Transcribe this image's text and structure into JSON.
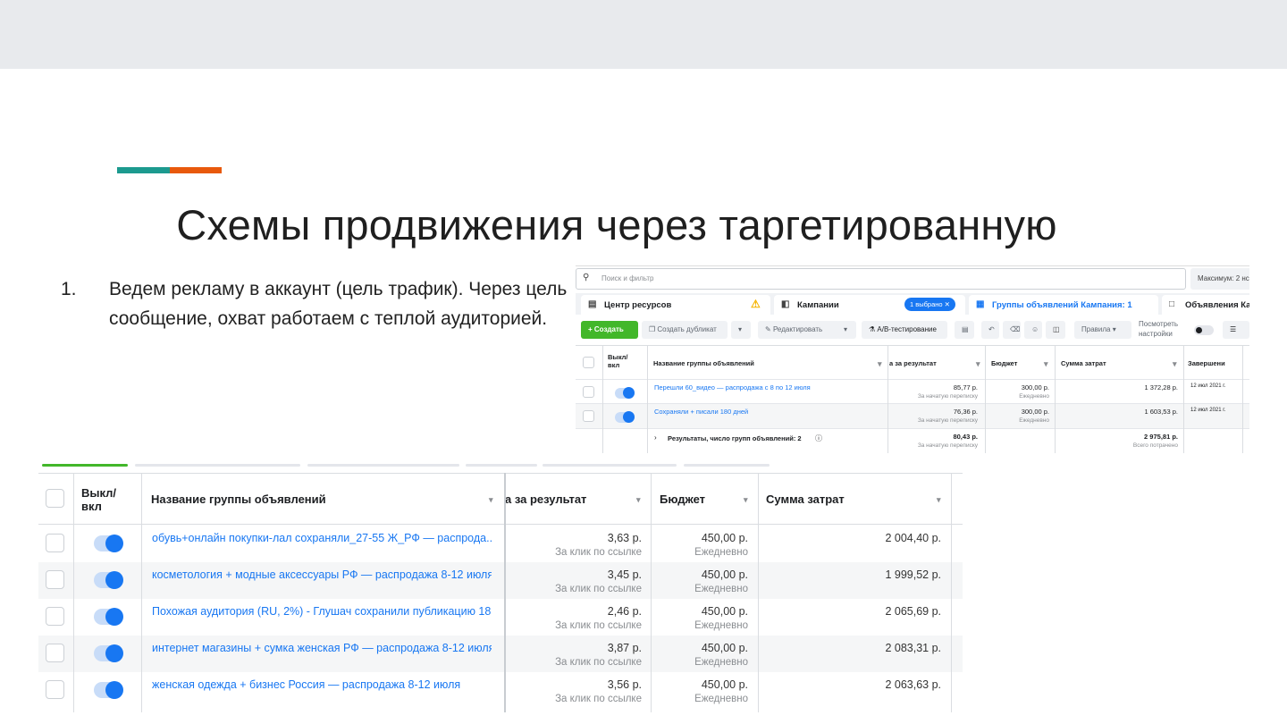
{
  "colors": {
    "accent_teal": "#1c9a8f",
    "accent_orange": "#e8590c",
    "fb_blue": "#1877f2",
    "fb_green": "#42b72a"
  },
  "slide": {
    "title": "Схемы продвижения через таргетированную",
    "bullet_number": "1.",
    "bullet_text": "Ведем рекламу в аккаунт (цель трафик). Через цель сообщение, охват работаем с теплой аудиторией."
  },
  "shot1": {
    "search_placeholder": "Поиск и фильтр",
    "max_label": "Максимум: 2 нс",
    "tabs": {
      "resources": "Центр ресурсов",
      "campaigns": "Кампании",
      "selected_badge": "1 выбрано",
      "groups": "Группы объявлений Кампания: 1",
      "ads": "Объявления Ка"
    },
    "toolbar": {
      "create": "+ Создать",
      "duplicate": "Создать дубликат",
      "edit": "Редактировать",
      "ab_test": "А/В-тестирование",
      "rules": "Правила",
      "view_line1": "Посмотреть",
      "view_line2": "настройки"
    },
    "headers": {
      "toggle": "Выкл/ вкл",
      "name": "Название группы объявлений",
      "cost": "а за результат",
      "budget": "Бюджет",
      "spend": "Сумма затрат",
      "end": "Завершени"
    },
    "rows": [
      {
        "name": "Перешли 60_видео — распродажа с 8 по 12 июля",
        "cost": "85,77 р.",
        "cost_sub": "За начатую переписку",
        "budget": "300,00 р.",
        "budget_sub": "Ежедневно",
        "spend": "1 372,28 р.",
        "end": "12 июл 2021 г."
      },
      {
        "name": "Сохраняли + писали 180 дней",
        "cost": "76,36 р.",
        "cost_sub": "За начатую переписку",
        "budget": "300,00 р.",
        "budget_sub": "Ежедневно",
        "spend": "1 603,53 р.",
        "end": "12 июл 2021 г."
      }
    ],
    "total": {
      "label": "Результаты, число групп объявлений: 2",
      "cost": "80,43 р.",
      "cost_sub": "За начатую переписку",
      "spend": "2 975,81 р.",
      "spend_sub": "Всего потрачено"
    }
  },
  "shot2": {
    "headers": {
      "toggle": "Выкл/ вкл",
      "name": "Название группы объявлений",
      "cost": "а за результат",
      "budget": "Бюджет",
      "spend": "Сумма затрат"
    },
    "rows": [
      {
        "name": "обувь+онлайн покупки-лал сохраняли_27-55 Ж_РФ — распрода...",
        "cost": "3,63 р.",
        "cost_sub": "За клик по ссылке",
        "budget": "450,00 р.",
        "budget_sub": "Ежедневно",
        "spend": "2 004,40 р."
      },
      {
        "name": "косметология + модные аксессуары РФ — распродажа 8-12 июля",
        "cost": "3,45 р.",
        "cost_sub": "За клик по ссылке",
        "budget": "450,00 р.",
        "budget_sub": "Ежедневно",
        "spend": "1 999,52 р."
      },
      {
        "name": "Похожая аудитория (RU, 2%) - Глушач сохранили публикацию 18...",
        "cost": "2,46 р.",
        "cost_sub": "За клик по ссылке",
        "budget": "450,00 р.",
        "budget_sub": "Ежедневно",
        "spend": "2 065,69 р."
      },
      {
        "name": "интернет магазины + сумка женская РФ — распродажа 8-12 июля",
        "cost": "3,87 р.",
        "cost_sub": "За клик по ссылке",
        "budget": "450,00 р.",
        "budget_sub": "Ежедневно",
        "spend": "2 083,31 р."
      },
      {
        "name": "женская одежда + бизнес Россия — распродажа 8-12 июля",
        "cost": "3,56 р.",
        "cost_sub": "За клик по ссылке",
        "budget": "450,00 р.",
        "budget_sub": "Ежедневно",
        "spend": "2 063,63 р."
      }
    ]
  }
}
